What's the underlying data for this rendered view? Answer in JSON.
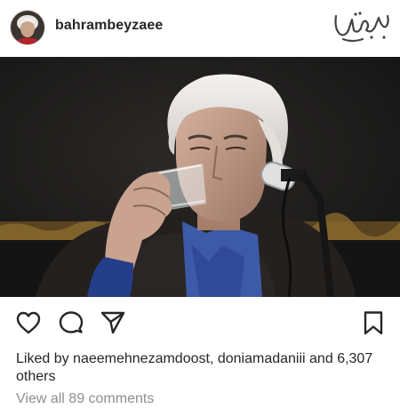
{
  "post": {
    "username": "bahrambeyzaee",
    "likes_prefix": "Liked by",
    "liked_by_1": "naeemehnezamdoost",
    "liked_by_sep": ",",
    "liked_by_2": "doniamadaniii",
    "likes_and": "and",
    "likes_count": "6,307 others",
    "view_comments": "View all 89 comments"
  },
  "icons": {
    "like": "heart-icon",
    "comment": "comment-icon",
    "share": "send-icon",
    "save": "bookmark-icon"
  },
  "colors": {
    "text": "#262626",
    "muted": "#8e8e8e",
    "photo_background": "#1f1f1f"
  }
}
